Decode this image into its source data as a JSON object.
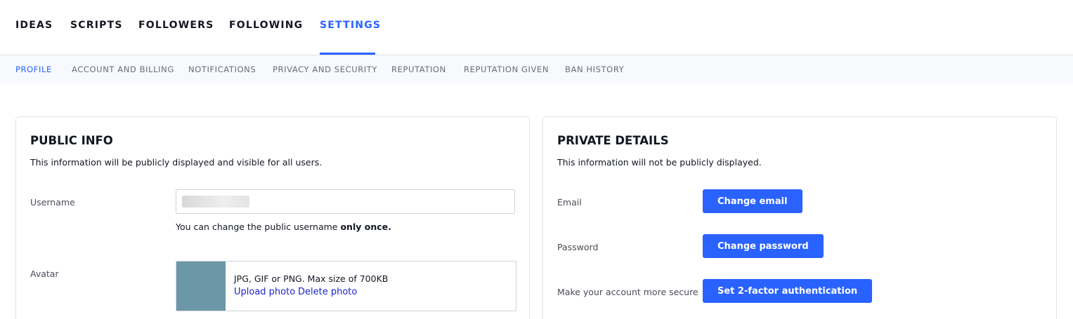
{
  "top_nav": {
    "tabs": [
      {
        "label": "IDEAS",
        "active": false
      },
      {
        "label": "SCRIPTS",
        "active": false
      },
      {
        "label": "FOLLOWERS",
        "active": false
      },
      {
        "label": "FOLLOWING",
        "active": false
      },
      {
        "label": "SETTINGS",
        "active": true
      }
    ]
  },
  "sub_nav": {
    "tabs": [
      {
        "label": "PROFILE",
        "active": true
      },
      {
        "label": "ACCOUNT AND BILLING",
        "active": false
      },
      {
        "label": "NOTIFICATIONS",
        "active": false
      },
      {
        "label": "PRIVACY AND SECURITY",
        "active": false
      },
      {
        "label": "REPUTATION",
        "active": false
      },
      {
        "label": "REPUTATION GIVEN",
        "active": false
      },
      {
        "label": "BAN HISTORY",
        "active": false
      }
    ]
  },
  "public_info": {
    "title": "PUBLIC INFO",
    "description": "This information will be publicly displayed and visible for all users.",
    "username_label": "Username",
    "username_value": "",
    "username_hint_prefix": "You can change the public username ",
    "username_hint_bold": "only once.",
    "avatar_label": "Avatar",
    "avatar_hint": "JPG, GIF or PNG. Max size of 700KB",
    "upload_label": "Upload photo",
    "delete_label": "Delete photo"
  },
  "private_details": {
    "title": "PRIVATE DETAILS",
    "description": "This information will not be publicly displayed.",
    "email_label": "Email",
    "email_button": "Change email",
    "password_label": "Password",
    "password_button": "Change password",
    "security_label": "Make your account more secure",
    "security_button": "Set 2-factor authentication"
  },
  "colors": {
    "accent": "#2962ff",
    "link": "#1b26c7",
    "subnav_bg": "#f8f9fd",
    "avatar_placeholder": "#6b97a6"
  }
}
